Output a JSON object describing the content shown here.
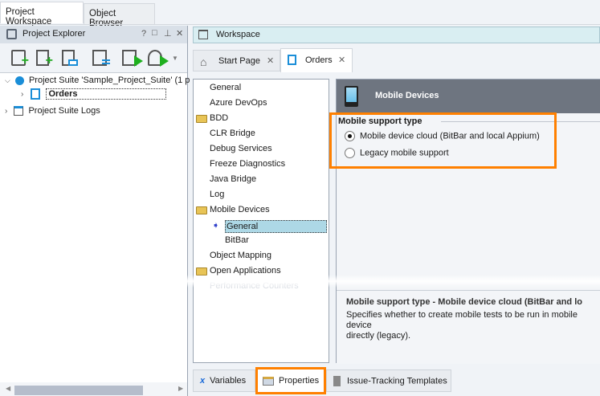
{
  "top_tabs": [
    {
      "label": "Project Workspace",
      "active": true
    },
    {
      "label": "Object Browser",
      "active": false
    }
  ],
  "explorer": {
    "title": "Project Explorer",
    "controls": [
      "?",
      "□",
      "⊥",
      "✕"
    ],
    "toolbar": [
      "add-project-icon",
      "add-item-icon",
      "open-existing-icon",
      "project-properties-icon",
      "run-project-icon",
      "run-suite-icon"
    ],
    "tree": [
      {
        "label": "Project Suite 'Sample_Project_Suite' (1 p",
        "expanded": true
      },
      {
        "label": "Orders",
        "selected": true
      },
      {
        "label": "Project Suite Logs"
      }
    ]
  },
  "workspace": {
    "title": "Workspace",
    "tabs": [
      {
        "label": "Start Page",
        "active": false
      },
      {
        "label": "Orders",
        "active": true
      }
    ],
    "categories": [
      {
        "label": "General",
        "folder": false,
        "indent": 0
      },
      {
        "label": "Azure DevOps",
        "folder": false,
        "indent": 0
      },
      {
        "label": "BDD",
        "folder": true,
        "indent": 0
      },
      {
        "label": "CLR Bridge",
        "folder": false,
        "indent": 0
      },
      {
        "label": "Debug Services",
        "folder": false,
        "indent": 0
      },
      {
        "label": "Freeze Diagnostics",
        "folder": false,
        "indent": 0
      },
      {
        "label": "Java Bridge",
        "folder": false,
        "indent": 0
      },
      {
        "label": "Log",
        "folder": false,
        "indent": 0
      },
      {
        "label": "Mobile Devices",
        "folder": true,
        "indent": 0
      },
      {
        "label": "General",
        "folder": false,
        "indent": 1,
        "selected": true
      },
      {
        "label": "BitBar",
        "folder": false,
        "indent": 1
      },
      {
        "label": "Object Mapping",
        "folder": false,
        "indent": 0
      },
      {
        "label": "Open Applications",
        "folder": true,
        "indent": 0
      },
      {
        "label": "Performance Counters",
        "folder": false,
        "indent": 0,
        "faded": true
      }
    ],
    "panel_title": "Mobile Devices",
    "group_title": "Mobile support type",
    "options": [
      {
        "label": "Mobile device cloud (BitBar and local Appium)",
        "checked": true
      },
      {
        "label": "Legacy mobile support",
        "checked": false
      }
    ],
    "description_title": "Mobile support type - Mobile device cloud (BitBar and lo",
    "description_text": "Specifies whether to create mobile tests to be run in mobile device",
    "description_text2": "directly (legacy).",
    "bottom_tabs": [
      {
        "label": "Variables"
      },
      {
        "label": "Properties",
        "active": true
      },
      {
        "label": "Issue-Tracking Templates"
      }
    ]
  },
  "colors": {
    "highlight": "#ff8000",
    "panel_header": "#6e7580",
    "selection": "#add8e6",
    "workspace_header": "#d9eef2"
  }
}
